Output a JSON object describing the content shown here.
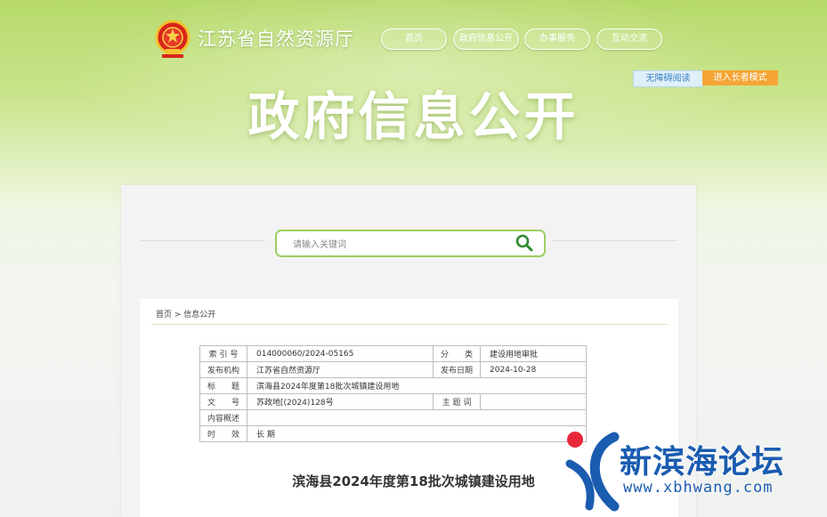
{
  "header": {
    "site_title": "江苏省自然资源厅",
    "nav": [
      "首页",
      "政府信息公开",
      "办事服务",
      "互动交流"
    ],
    "accessibility": "无障碍阅读",
    "elder_mode": "进入长者模式",
    "banner_title": "政府信息公开"
  },
  "search": {
    "placeholder": "请输入关键词"
  },
  "breadcrumb": "首页 > 信息公开",
  "meta": {
    "index_label": "索 引 号",
    "index_value": "014000060/2024-05165",
    "category_label": "分　　类",
    "category_value": "建设用地审批",
    "publisher_label": "发布机构",
    "publisher_value": "江苏省自然资源厅",
    "date_label": "发布日期",
    "date_value": "2024-10-28",
    "title_label": "标　　题",
    "title_value": "滨海县2024年度第18批次城镇建设用地",
    "docno_label": "文　　号",
    "docno_value": "苏政地[(2024)128号",
    "keyword_label": "主 题 词",
    "keyword_value": "",
    "summary_label": "内容概述",
    "summary_value": "",
    "validity_label": "时　　效",
    "validity_value": "长 期"
  },
  "document_title": "滨海县2024年度第18批次城镇建设用地",
  "watermark": {
    "name": "新滨海论坛",
    "url": "www.xbhwang.com"
  },
  "colors": {
    "accent_green": "#9ccd63",
    "elder_orange": "#f5a535",
    "watermark_blue": "#1a5cb0"
  }
}
